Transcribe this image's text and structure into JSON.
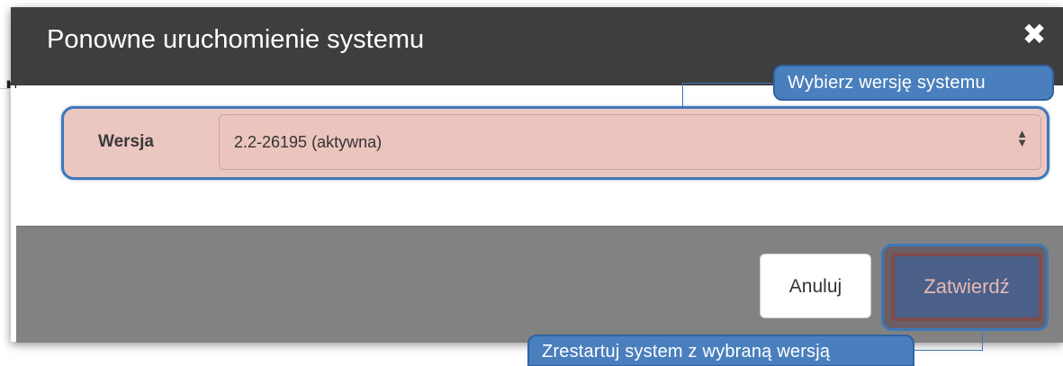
{
  "background": {
    "heading_fragment": "ng"
  },
  "dialog": {
    "title": "Ponowne uruchomienie systemu",
    "close_icon": "close-icon",
    "version_field": {
      "label": "Wersja",
      "selected_value": "2.2-26195 (aktywna)"
    },
    "buttons": {
      "cancel_label": "Anuluj",
      "submit_label": "Zatwierdź"
    }
  },
  "tooltips": {
    "select_version": "Wybierz wersję systemu",
    "restart_with_version": "Zrestartuj system z wybraną wersją"
  },
  "colors": {
    "header_bg": "#3e3e3e",
    "footer_bg": "#828282",
    "highlight_bg": "#ecc6c0",
    "tooltip_bg": "#4a7fbd",
    "submit_bg": "#4b6089"
  }
}
